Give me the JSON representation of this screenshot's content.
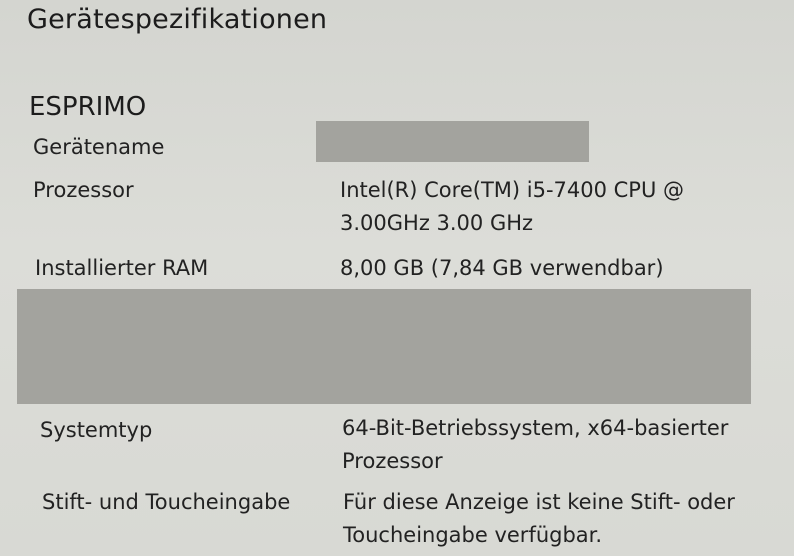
{
  "section": {
    "title": "Gerätespezifikationen",
    "device_model": "ESPRIMO"
  },
  "specs": {
    "device_name_label": "Gerätename",
    "processor_label": "Prozessor",
    "processor_value_line1": "Intel(R) Core(TM) i5-7400 CPU @",
    "processor_value_line2": "3.00GHz   3.00 GHz",
    "ram_label": "Installierter RAM",
    "ram_value": "8,00 GB (7,84 GB verwendbar)",
    "system_type_label": "Systemtyp",
    "system_type_value_line1": "64-Bit-Betriebssystem, x64-basierter",
    "system_type_value_line2": "Prozessor",
    "pen_touch_label": "Stift- und Toucheingabe",
    "pen_touch_value_line1": "Für diese Anzeige ist keine Stift- oder",
    "pen_touch_value_line2": "Toucheingabe verfügbar."
  },
  "colors": {
    "background": "#d8d9d4",
    "redaction": "#a3a39e",
    "text": "#222222"
  }
}
